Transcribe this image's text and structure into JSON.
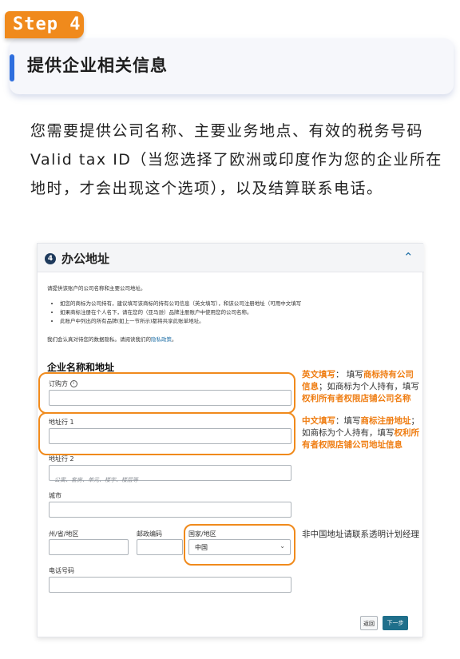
{
  "step_badge": "Step 4",
  "header_title": "提供企业相关信息",
  "intro_text": "您需要提供公司名称、主要业务地点、有效的税务号码 Valid tax ID（当您选择了欧洲或印度作为您的企业所在地时，才会出现这个选项），以及结算联系电话。",
  "form": {
    "section_number": "4",
    "section_title": "办公地址",
    "intro": "请提供该账户的公司名称和主要公司地址。",
    "bullets": [
      "如您的商标为公司持有，建议填写该商标的持有公司信息（英文填写），和该公司注册地址（可用中文填写",
      "如果商标注册在个人名下，请在您的（亚马逊）品牌注册账户中使用您的公司名称。",
      "此账户中列出的所有品牌(如上一节所示)都将共享此账单地址。"
    ],
    "privacy_prefix": "我们会认真对待您的数据隐私。请阅读我们的",
    "privacy_link": "隐私政策",
    "privacy_suffix": "。",
    "group_title": "企业名称和地址",
    "company_label": "订购方",
    "address1_label": "地址行 1",
    "address2_label": "地址行 2",
    "address2_placeholder": "公寓、套房、单元、楼宇、楼层等",
    "city_label": "城市",
    "state_label": "州/省/地区",
    "postal_label": "邮政编码",
    "country_label": "国家/地区",
    "country_value": "中国",
    "phone_label": "电话号码",
    "back_button": "返回",
    "next_button": "下一步"
  },
  "annotations": {
    "note1_a": "英文填写",
    "note1_b": "： 填写",
    "note1_c": "商标持有公司信息",
    "note1_d": "；如商标为个人持有，填写",
    "note1_e": "权利所有者权限店铺公司名称",
    "note2_a": "中文填写",
    "note2_b": "：填写",
    "note2_c": "商标注册地址",
    "note2_d": "；如商标为个人持有，填写",
    "note2_e": "权利所有者权限店铺公司地址信息",
    "note3": "非中国地址请联系透明计划经理"
  },
  "colors": {
    "accent_orange": "#f08a1c",
    "header_blue": "#2f6fde",
    "button_teal": "#1f6f8b"
  }
}
